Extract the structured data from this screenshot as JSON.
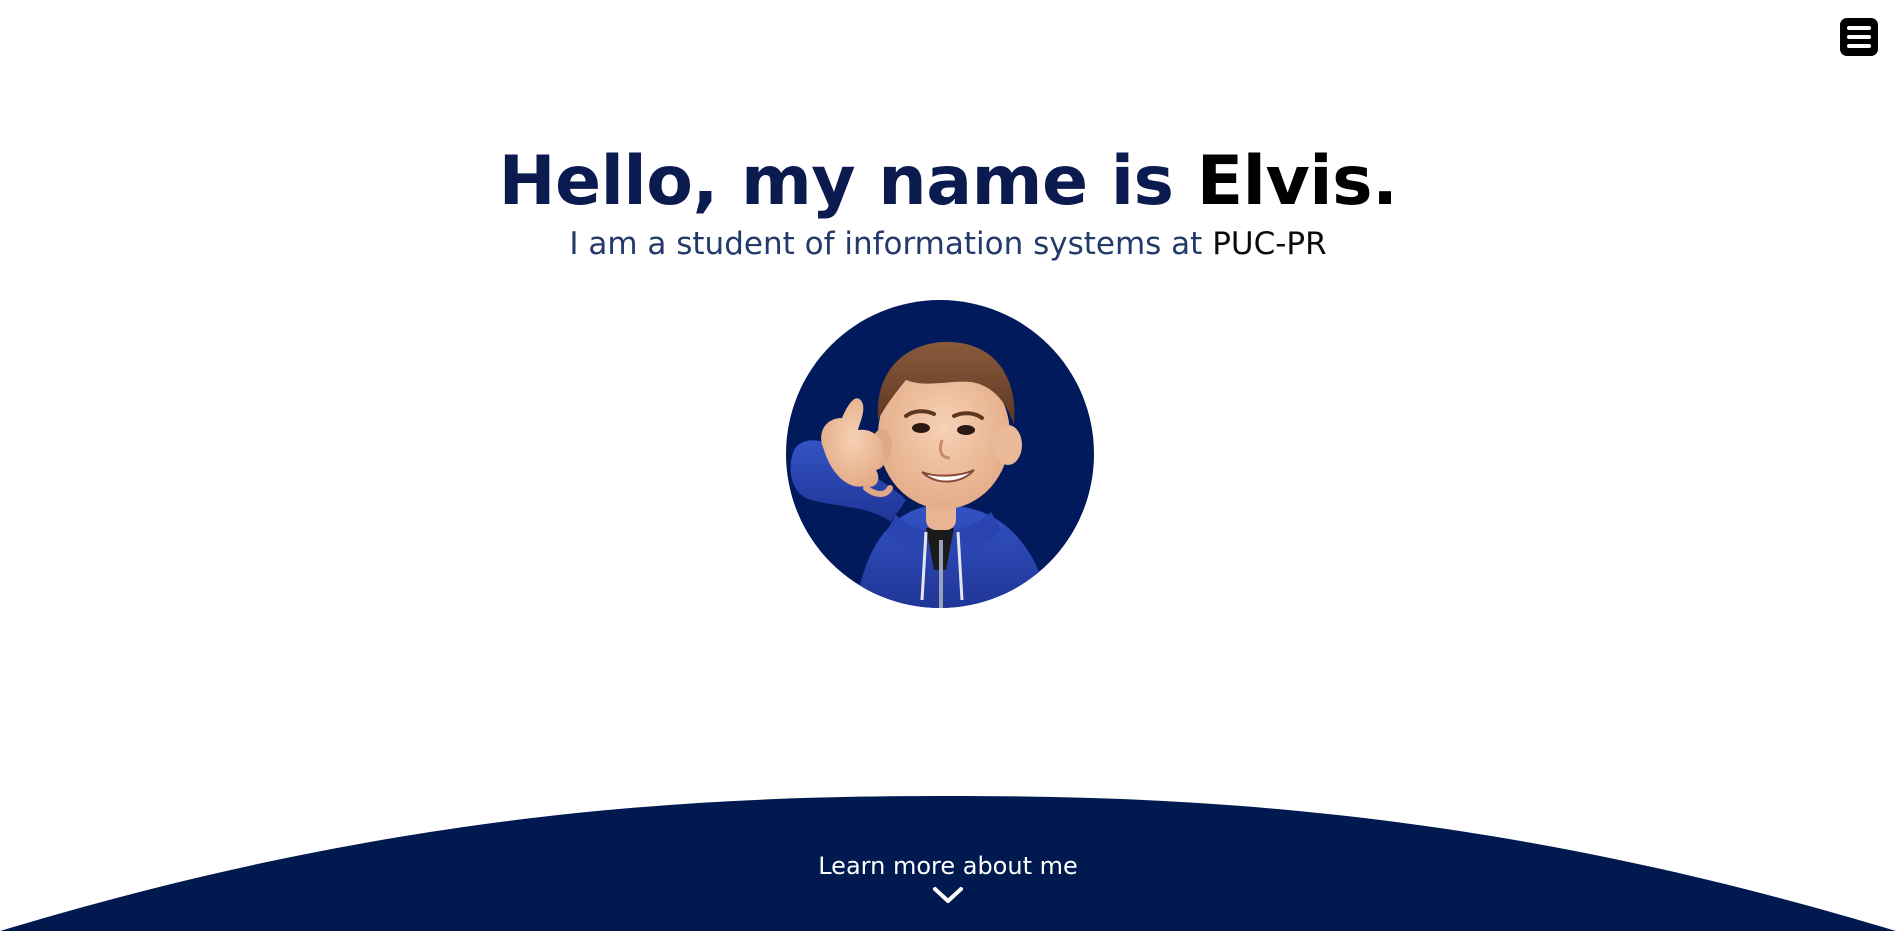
{
  "header": {
    "menu_icon": "hamburger-menu-icon"
  },
  "hero": {
    "title_prefix": "Hello, my name is ",
    "title_name": "Elvis.",
    "subtitle_prefix": "I am a student of information systems at ",
    "subtitle_school": "PUC-PR"
  },
  "cta": {
    "label": "Learn more about me",
    "icon": "chevron-down-icon"
  },
  "colors": {
    "navy": "#001a4f",
    "title_navy": "#0b1a4f",
    "hoodie_blue": "#2b45b0",
    "white": "#ffffff",
    "black": "#000000"
  }
}
